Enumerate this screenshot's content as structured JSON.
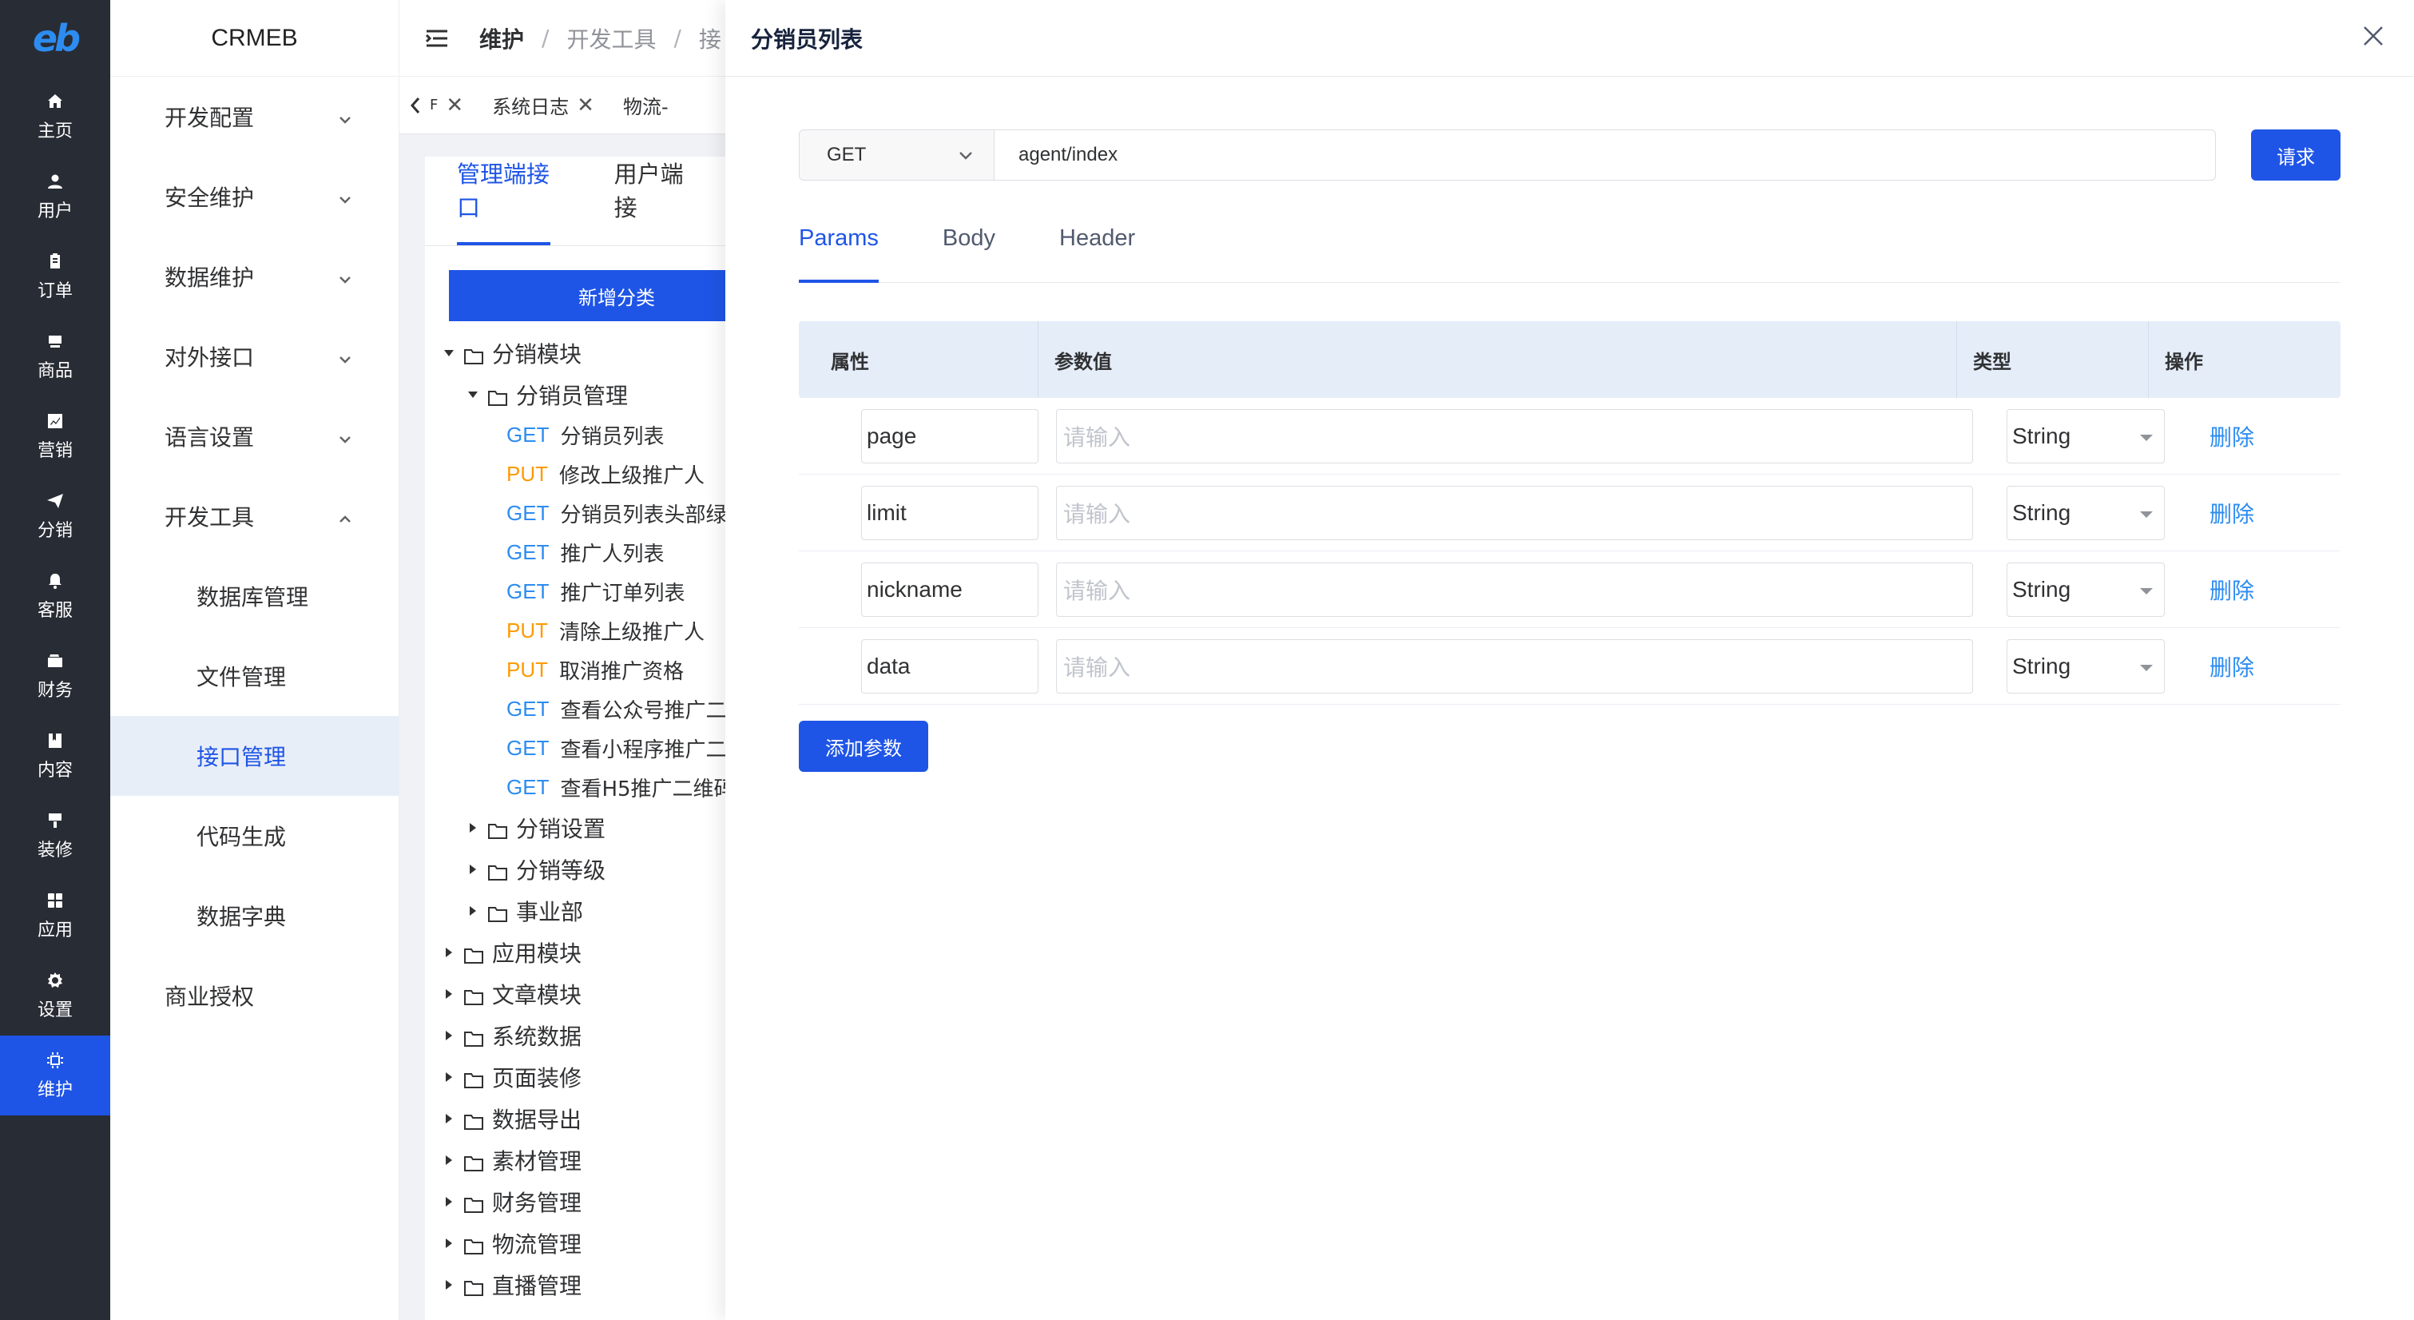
{
  "rail": {
    "logo": "eb",
    "items": [
      {
        "label": "主页",
        "icon": "home-icon"
      },
      {
        "label": "用户",
        "icon": "user-icon"
      },
      {
        "label": "订单",
        "icon": "order-icon"
      },
      {
        "label": "商品",
        "icon": "product-icon"
      },
      {
        "label": "营销",
        "icon": "marketing-icon"
      },
      {
        "label": "分销",
        "icon": "send-icon"
      },
      {
        "label": "客服",
        "icon": "bell-icon"
      },
      {
        "label": "财务",
        "icon": "wallet-icon"
      },
      {
        "label": "内容",
        "icon": "book-icon"
      },
      {
        "label": "装修",
        "icon": "brush-icon"
      },
      {
        "label": "应用",
        "icon": "grid-icon"
      },
      {
        "label": "设置",
        "icon": "gear-icon"
      },
      {
        "label": "维护",
        "icon": "chip-icon"
      }
    ]
  },
  "submenu": {
    "brand": "CRMEB",
    "groups": [
      {
        "label": "开发配置"
      },
      {
        "label": "安全维护"
      },
      {
        "label": "数据维护"
      },
      {
        "label": "对外接口"
      },
      {
        "label": "语言设置"
      },
      {
        "label": "开发工具"
      }
    ],
    "children": [
      {
        "label": "数据库管理"
      },
      {
        "label": "文件管理"
      },
      {
        "label": "接口管理"
      },
      {
        "label": "代码生成"
      },
      {
        "label": "数据字典"
      }
    ],
    "last": "商业授权"
  },
  "header": {
    "crumbs": [
      "维护",
      "开发工具",
      "接"
    ],
    "separator": "/"
  },
  "tags": [
    {
      "label": "F"
    },
    {
      "label": "系统日志"
    },
    {
      "label": "物流-"
    }
  ],
  "api": {
    "tabs": [
      "管理端接口",
      "用户端接"
    ],
    "add_category": "新增分类",
    "tree": [
      {
        "label": "分销模块",
        "open": true,
        "level": 0
      },
      {
        "label": "分销员管理",
        "open": true,
        "level": 1
      }
    ],
    "leaves": [
      {
        "method": "GET",
        "label": "分销员列表"
      },
      {
        "method": "PUT",
        "label": "修改上级推广人"
      },
      {
        "method": "GET",
        "label": "分销员列表头部绿"
      },
      {
        "method": "GET",
        "label": "推广人列表"
      },
      {
        "method": "GET",
        "label": "推广订单列表"
      },
      {
        "method": "PUT",
        "label": "清除上级推广人"
      },
      {
        "method": "PUT",
        "label": "取消推广资格"
      },
      {
        "method": "GET",
        "label": "查看公众号推广二"
      },
      {
        "method": "GET",
        "label": "查看小程序推广二"
      },
      {
        "method": "GET",
        "label": "查看H5推广二维码"
      }
    ],
    "sub_folders": [
      "分销设置",
      "分销等级",
      "事业部"
    ],
    "top_folders": [
      "应用模块",
      "文章模块",
      "系统数据",
      "页面装修",
      "数据导出",
      "素材管理",
      "财务管理",
      "物流管理",
      "直播管理"
    ]
  },
  "drawer": {
    "title": "分销员列表",
    "method": "GET",
    "url": "agent/index",
    "send": "请求",
    "tabs": [
      "Params",
      "Body",
      "Header"
    ],
    "columns": [
      "属性",
      "参数值",
      "类型",
      "操作"
    ],
    "rows": [
      {
        "name": "page",
        "value_placeholder": "请输入",
        "type": "String",
        "action": "删除"
      },
      {
        "name": "limit",
        "value_placeholder": "请输入",
        "type": "String",
        "action": "删除"
      },
      {
        "name": "nickname",
        "value_placeholder": "请输入",
        "type": "String",
        "action": "删除"
      },
      {
        "name": "data",
        "value_placeholder": "请输入",
        "type": "String",
        "action": "删除"
      }
    ],
    "add_param": "添加参数"
  },
  "colors": {
    "primary": "#1f55e6",
    "rail_bg": "#282c34",
    "get": "#2d8cf0",
    "put": "#ff9900",
    "table_head": "#e5edf9"
  }
}
